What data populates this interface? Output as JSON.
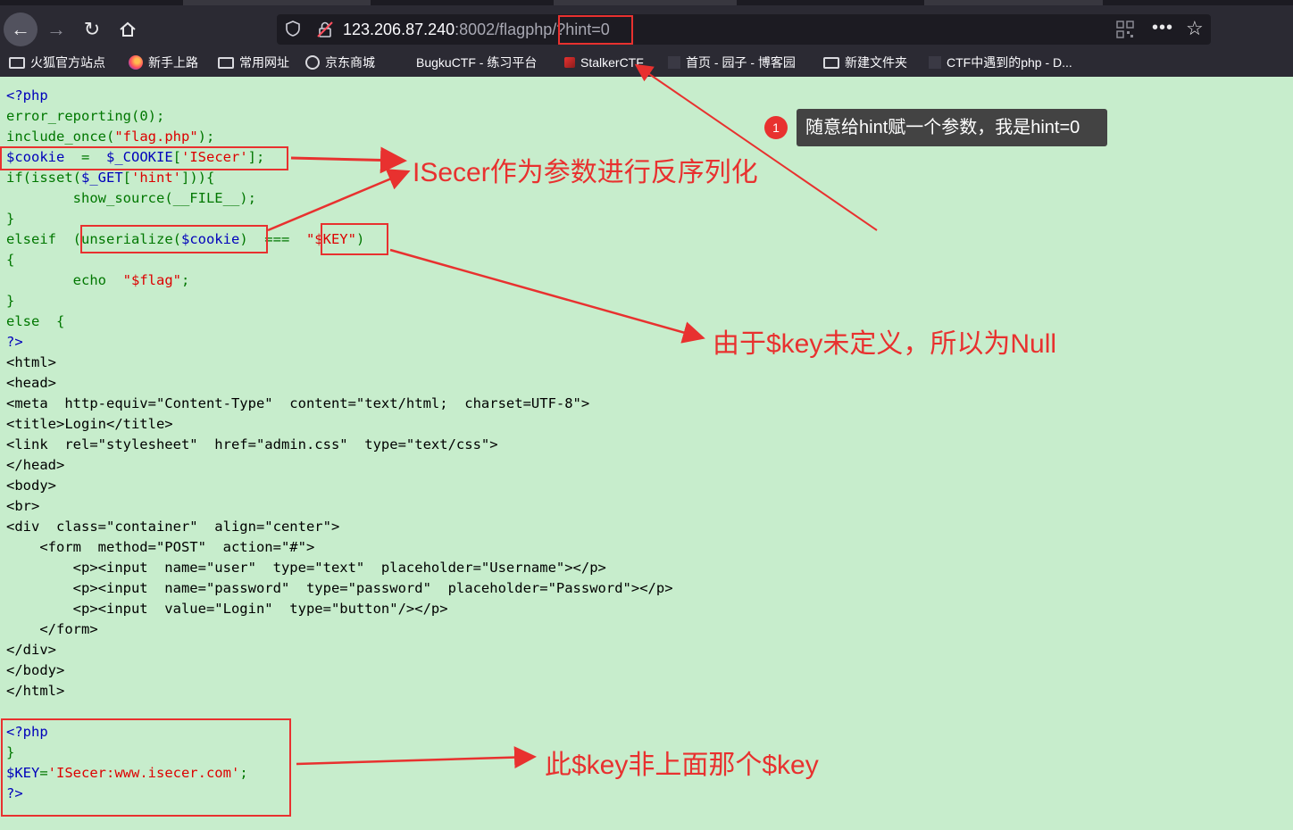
{
  "browser": {
    "url_host": "123.206.87.240",
    "url_rest": ":8002/flagphp/?hint=0",
    "bookmarks": [
      {
        "label": "火狐官方站点",
        "icon": "folder-icon"
      },
      {
        "label": "新手上路",
        "icon": "firefox-icon"
      },
      {
        "label": "常用网址",
        "icon": "folder-icon"
      },
      {
        "label": "京东商城",
        "icon": "globe-icon"
      },
      {
        "label": "BugkuCTF - 练习平台",
        "icon": "none"
      },
      {
        "label": "StalkerCTF",
        "icon": "stalker-icon"
      },
      {
        "label": "首页 - 园子 - 博客园",
        "icon": "cnblogs-icon"
      },
      {
        "label": "新建文件夹",
        "icon": "folder-icon"
      },
      {
        "label": "CTF中遇到的php - D...",
        "icon": "ctf-icon"
      }
    ]
  },
  "code_lines": [
    "<?php",
    "error_reporting(0);",
    "include_once(\"flag.php\");",
    "$cookie  =  $_COOKIE['ISecer'];",
    "if(isset($_GET['hint'])){",
    "        show_source(__FILE__);",
    "}",
    "elseif  (unserialize($cookie)  ===  \"$KEY\")",
    "{",
    "        echo  \"$flag\";",
    "}",
    "else  {",
    "?>",
    "<html>",
    "<head>",
    "<meta  http-equiv=\"Content-Type\"  content=\"text/html;  charset=UTF-8\">",
    "<title>Login</title>",
    "<link  rel=\"stylesheet\"  href=\"admin.css\"  type=\"text/css\">",
    "</head>",
    "<body>",
    "<br>",
    "<div  class=\"container\"  align=\"center\">",
    "    <form  method=\"POST\"  action=\"#\">",
    "        <p><input  name=\"user\"  type=\"text\"  placeholder=\"Username\"></p>",
    "        <p><input  name=\"password\"  type=\"password\"  placeholder=\"Password\"></p>",
    "        <p><input  value=\"Login\"  type=\"button\"/></p>",
    "    </form>",
    "</div>",
    "</body>",
    "</html>",
    "",
    "<?php",
    "}",
    "$KEY='ISecer:www.isecer.com';",
    "?>"
  ],
  "annotations": {
    "badge_number": "1",
    "hint_tooltip": "随意给hint赋一个参数，我是hint=0",
    "isecer_note": "ISecer作为参数进行反序列化",
    "key_null_note": "由于$key未定义，所以为Null",
    "key_not_same_note": "此$key非上面那个$key"
  },
  "colors": {
    "background": "#c7edcc",
    "annotation_red": "#e8312f",
    "php_keyword": "#007700",
    "php_variable": "#0000bb",
    "php_string": "#dd0000"
  }
}
